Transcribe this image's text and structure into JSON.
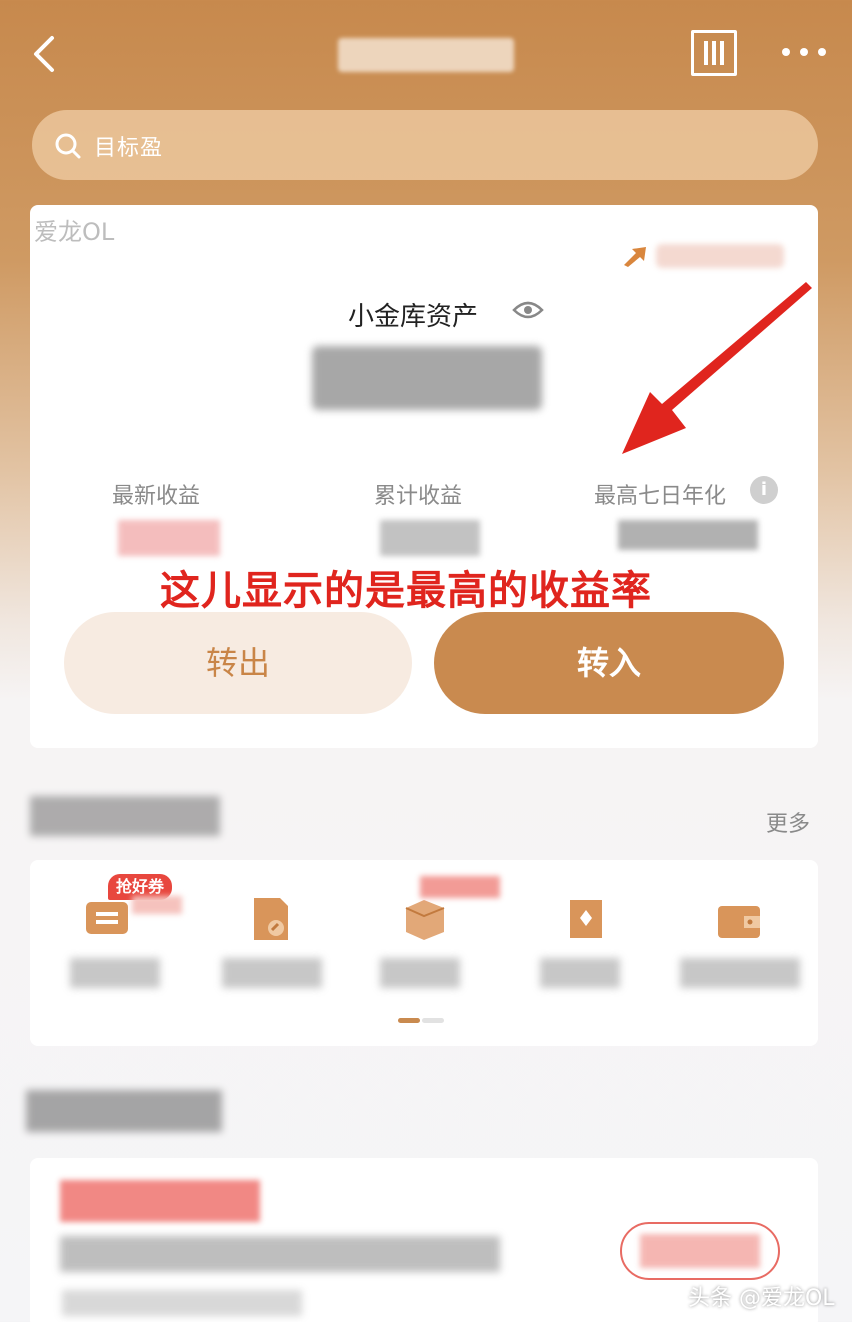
{
  "header": {
    "back_icon": "chevron-left-icon",
    "menu_icon": "grid-columns-icon",
    "more_icon": "more-dots-icon"
  },
  "search": {
    "placeholder": "目标盈",
    "icon": "search-icon"
  },
  "watermark_top": "爱龙OL",
  "asset_card": {
    "title": "小金库资产",
    "eye_icon": "eye-icon",
    "metrics": [
      {
        "label": "最新收益"
      },
      {
        "label": "累计收益"
      },
      {
        "label": "最高七日年化",
        "info_icon": "info-icon"
      }
    ],
    "annotation": "这儿显示的是最高的收益率",
    "annotation_color": "#e0251e",
    "transfer_out_label": "转出",
    "transfer_in_label": "转入"
  },
  "tasks_section": {
    "more_label": "更多",
    "badge_label": "抢好券",
    "items": [
      {
        "icon": "coupon-icon"
      },
      {
        "icon": "document-icon"
      },
      {
        "icon": "box-icon"
      },
      {
        "icon": "card-icon"
      },
      {
        "icon": "wallet-icon"
      }
    ]
  },
  "watermark_bottom": "头条 @爱龙OL",
  "colors": {
    "accent": "#c98a4f",
    "accent_light": "#f7ebe1",
    "header_bg": "#c7894d"
  }
}
